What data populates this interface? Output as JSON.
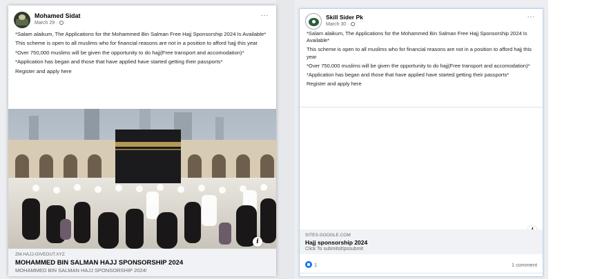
{
  "left_post": {
    "author": "Mohamed Sidat",
    "date": "March 29",
    "dot": "·",
    "more": "···",
    "paragraphs": [
      "*Salam alaikum, The Applications for the Mohammed Bin Salman Free Hajj Sponsorship 2024 Is Available*",
      "This scheme is open to all muslims who for financial reasons are not in a position to afford hajj this year",
      "*Over 750,000 muslims will be given the opportunity to do hajj(Free transport and accomodation)*",
      "*Application has began and those that have applied have started getting their passports*",
      "Register and apply here"
    ],
    "info": "i",
    "link": {
      "domain": "ZM.HAJJ-GIVEOUT.XYZ",
      "title": "MOHAMMED BIN SALMAN HAJJ SPONSORSHIP 2024",
      "subtitle": "MOHAMMED BIN SALMAN HAJJ SPONSORSHIP 2024!"
    }
  },
  "right_post": {
    "author": "Skill Sider Pk",
    "date": "March 30",
    "dot": "·",
    "more": "···",
    "paragraphs": [
      "*Salam alaikum, The Applications for the Mohammed Bin Salman Free Hajj Sponsorship 2024 Is Available*",
      "This scheme is open to all muslims who for financial reasons are not in a position to afford hajj this year",
      "*Over 750,000 muslims will be given the opportunity to do hajj(Free transport and accomodation)*",
      "*Application has began and those that have applied have started getting their passports*",
      "Register and apply here"
    ],
    "info": "i",
    "link": {
      "domain": "SITES.GOOGLE.COM",
      "title": "Hajj sponsorship 2024",
      "subtitle": "Click To submitsit!pssubmit"
    },
    "reaction_count": "1",
    "comments": "1 comment"
  },
  "colors": {
    "brand": "#1877f2",
    "link_bg": "#f0f2f5",
    "muted": "#65676b"
  }
}
